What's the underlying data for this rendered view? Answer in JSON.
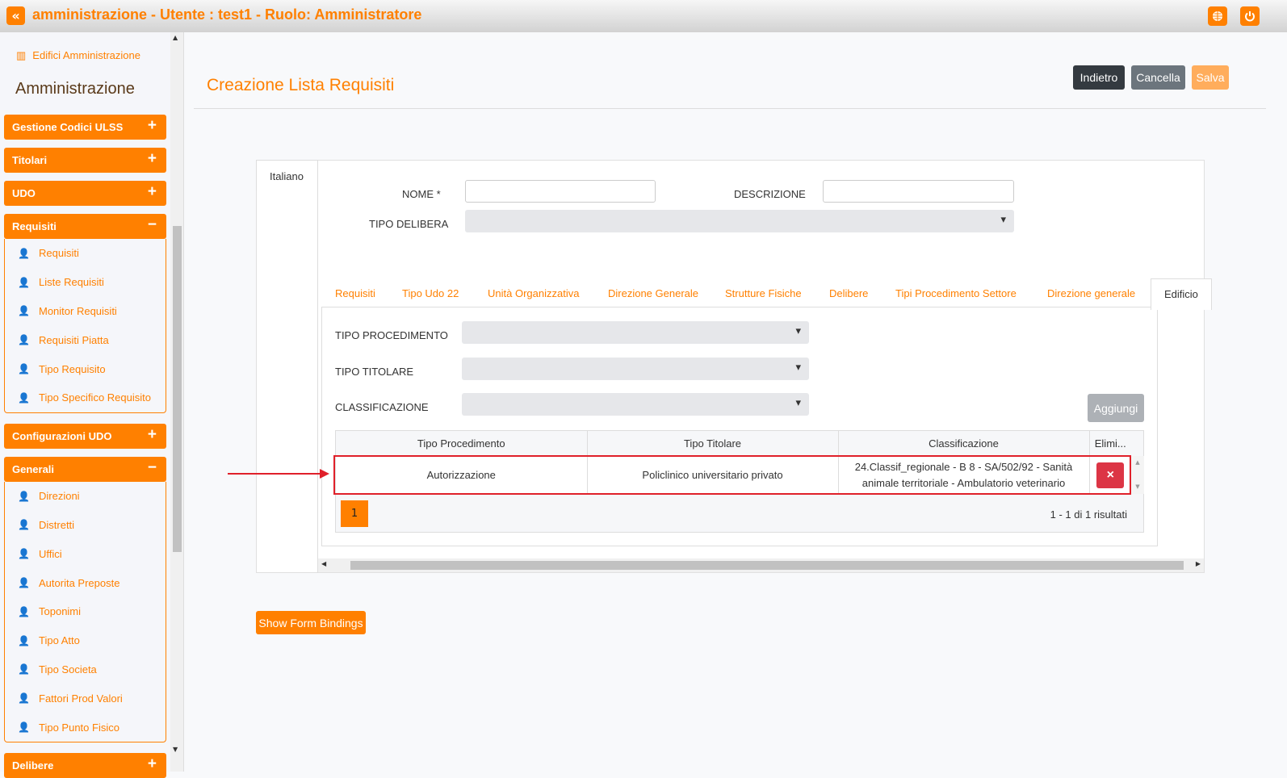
{
  "header": {
    "title": "amministrazione - Utente : test1 - Ruolo: Amministratore",
    "collapse_icon": "«",
    "globe_icon": "globe",
    "power_icon": "power"
  },
  "sidebar": {
    "top_link": "Edifici Amministrazione",
    "heading": "Amministrazione",
    "sections": [
      {
        "label": "Gestione Codici ULSS",
        "toggle": "+"
      },
      {
        "label": "Titolari",
        "toggle": "+"
      },
      {
        "label": "UDO",
        "toggle": "+"
      },
      {
        "label": "Requisiti",
        "toggle": "−",
        "items": [
          "Requisiti",
          "Liste Requisiti",
          "Monitor Requisiti",
          "Requisiti Piatta",
          "Tipo Requisito",
          "Tipo Specifico Requisito"
        ]
      },
      {
        "label": "Configurazioni UDO",
        "toggle": "+"
      },
      {
        "label": "Generali",
        "toggle": "−",
        "items": [
          "Direzioni",
          "Distretti",
          "Uffici",
          "Autorita Preposte",
          "Toponimi",
          "Tipo Atto",
          "Tipo Societa",
          "Fattori Prod Valori",
          "Tipo Punto Fisico"
        ]
      },
      {
        "label": "Delibere",
        "toggle": "+"
      }
    ]
  },
  "page": {
    "title": "Creazione Lista Requisiti",
    "buttons": {
      "back": "Indietro",
      "cancel": "Cancella",
      "save": "Salva"
    }
  },
  "form": {
    "lang_tab": "Italiano",
    "nome_label": "NOME *",
    "nome_value": "",
    "descrizione_label": "DESCRIZIONE",
    "descrizione_value": "",
    "tipo_delibera_label": "TIPO DELIBERA",
    "tipo_delibera_value": ""
  },
  "tabs": [
    "Requisiti",
    "Tipo Udo 22",
    "Unità Organizzativa",
    "Direzione Generale",
    "Strutture Fisiche",
    "Delibere",
    "Tipi Procedimento Settore",
    "Direzione generale",
    "Edificio"
  ],
  "active_tab": "Edificio",
  "edificio": {
    "tipo_procedimento_label": "TIPO PROCEDIMENTO",
    "tipo_titolare_label": "TIPO TITOLARE",
    "classificazione_label": "CLASSIFICAZIONE",
    "add_button": "Aggiungi",
    "table": {
      "columns": [
        "Tipo Procedimento",
        "Tipo Titolare",
        "Classificazione",
        "Elimi..."
      ],
      "rows": [
        {
          "tipo_procedimento": "Autorizzazione",
          "tipo_titolare": "Policlinico universitario privato",
          "classificazione": "24.Classif_regionale - B 8 - SA/502/92 - Sanità animale territoriale - Ambulatorio veterinario",
          "delete": "×"
        }
      ]
    },
    "pager": {
      "page": "1",
      "summary": "1 - 1 di 1 risultati"
    }
  },
  "footer_button": "Show Form Bindings",
  "colors": {
    "accent": "#ff8000",
    "highlight": "#e0202a",
    "delete": "#dc3545"
  }
}
